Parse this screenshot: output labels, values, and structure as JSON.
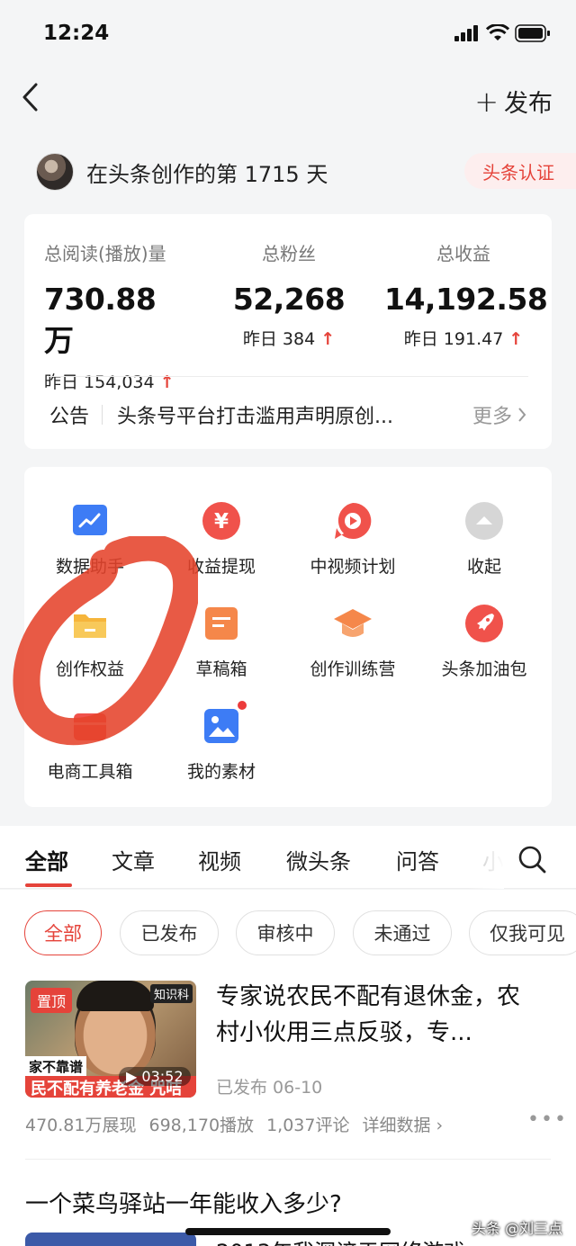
{
  "status_bar": {
    "time": "12:24"
  },
  "nav": {
    "publish_label": "发布"
  },
  "creator": {
    "text": "在头条创作的第 1715 天",
    "badge": "头条认证"
  },
  "stats": [
    {
      "label": "总阅读(播放)量",
      "value": "730.88万",
      "yesterday": "昨日 154,034"
    },
    {
      "label": "总粉丝",
      "value": "52,268",
      "yesterday": "昨日 384"
    },
    {
      "label": "总收益",
      "value": "14,192.58",
      "yesterday": "昨日 191.47"
    }
  ],
  "notice": {
    "title": "公告",
    "text": "头条号平台打击滥用声明原创...",
    "more": "更多"
  },
  "tools": [
    {
      "label": "数据助手",
      "icon": "chart-icon",
      "color": "#3d7cf5"
    },
    {
      "label": "收益提现",
      "icon": "yuan-icon",
      "color": "#f0524b"
    },
    {
      "label": "中视频计划",
      "icon": "play-icon",
      "color": "#f0524b"
    },
    {
      "label": "收起",
      "icon": "collapse-icon",
      "color": "#d0d0d0"
    },
    {
      "label": "创作权益",
      "icon": "folder-icon",
      "color": "#f6b53b"
    },
    {
      "label": "草稿箱",
      "icon": "draft-icon",
      "color": "#f5874a"
    },
    {
      "label": "创作训练营",
      "icon": "graduation-cap-icon",
      "color": "#f5874a"
    },
    {
      "label": "头条加油包",
      "icon": "rocket-icon",
      "color": "#f0524b"
    },
    {
      "label": "电商工具箱",
      "icon": "shop-box-icon",
      "color": "#f0524b"
    },
    {
      "label": "我的素材",
      "icon": "image-icon",
      "color": "#3d7cf5"
    }
  ],
  "tabs": [
    "全部",
    "文章",
    "视频",
    "微头条",
    "问答",
    "小"
  ],
  "filters": [
    "全部",
    "已发布",
    "审核中",
    "未通过",
    "仅我可见"
  ],
  "article": {
    "pin": "置顶",
    "brand": "知识科",
    "caption_top": "家不靠谱",
    "caption_bottom": "民不配有养老金  咒咭",
    "duration": "03:52",
    "title": "专家说农民不配有退休金，农村小伙用三点反驳，专...",
    "status": "已发布  06-10",
    "metrics": {
      "impressions": "470.81万展现",
      "plays": "698,170播放",
      "comments": "1,037评论",
      "detail": "详细数据"
    }
  },
  "article2": {
    "title": "一个菜鸟驿站一年能收入多少?",
    "subtitle": "2013年我深谙于网络游戏"
  },
  "watermark": "头条 @刘三点"
}
